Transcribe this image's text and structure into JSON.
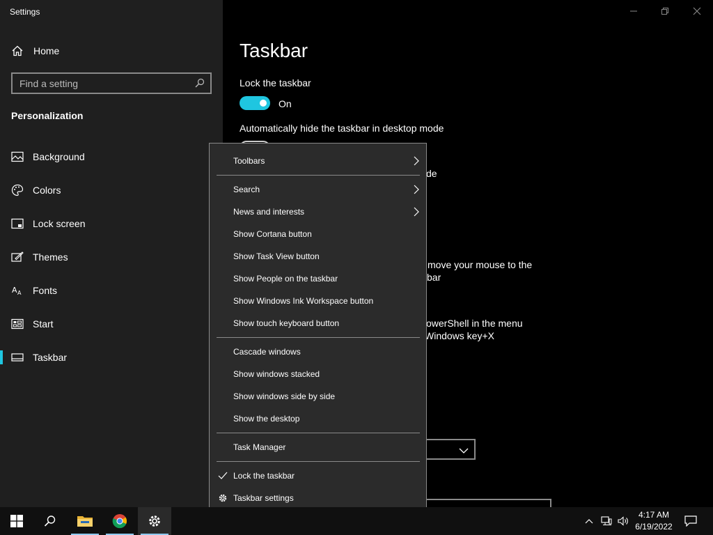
{
  "window": {
    "title": "Settings",
    "controls": [
      "minimize-icon",
      "restore-icon",
      "close-icon"
    ]
  },
  "sidebar": {
    "home_label": "Home",
    "search_placeholder": "Find a setting",
    "section_label": "Personalization",
    "items": [
      {
        "label": "Background",
        "icon": "background-icon"
      },
      {
        "label": "Colors",
        "icon": "palette-icon"
      },
      {
        "label": "Lock screen",
        "icon": "lock-screen-icon"
      },
      {
        "label": "Themes",
        "icon": "themes-icon"
      },
      {
        "label": "Fonts",
        "icon": "fonts-icon"
      },
      {
        "label": "Start",
        "icon": "start-icon"
      },
      {
        "label": "Taskbar",
        "icon": "taskbar-icon",
        "active": true
      }
    ]
  },
  "main": {
    "page_title": "Taskbar",
    "lock_label": "Lock the taskbar",
    "lock_state": "On",
    "autohide_label": "Automatically hide the taskbar in desktop mode",
    "obscured_fragments": [
      "de",
      "move your mouse to the",
      "bar",
      "owerShell in the menu",
      "Windows key+X"
    ]
  },
  "context_menu": {
    "items": [
      {
        "label": "Toolbars",
        "submenu": true
      },
      {
        "label": "Search",
        "submenu": true
      },
      {
        "label": "News and interests",
        "submenu": true
      },
      {
        "label": "Show Cortana button"
      },
      {
        "label": "Show Task View button"
      },
      {
        "label": "Show People on the taskbar"
      },
      {
        "label": "Show Windows Ink Workspace button"
      },
      {
        "label": "Show touch keyboard button"
      },
      {
        "label": "Cascade windows"
      },
      {
        "label": "Show windows stacked"
      },
      {
        "label": "Show windows side by side"
      },
      {
        "label": "Show the desktop"
      },
      {
        "label": "Task Manager"
      },
      {
        "label": "Lock the taskbar",
        "checked": true
      },
      {
        "label": "Taskbar settings",
        "icon": "gear-icon"
      }
    ]
  },
  "taskbar": {
    "apps": [
      "windows-start-icon",
      "search-icon",
      "file-explorer-icon",
      "chrome-icon",
      "settings-gear-icon"
    ],
    "tray_icons": [
      "chevron-up-icon",
      "network-icon",
      "volume-icon"
    ],
    "time": "4:17 AM",
    "date": "6/19/2022",
    "notification_icon": "action-center-icon"
  },
  "colors": {
    "accent": "#1FC6E0",
    "sidebar_bg": "#1F1F1F",
    "menu_bg": "#2B2B2B",
    "taskbar_bg": "#101010"
  }
}
